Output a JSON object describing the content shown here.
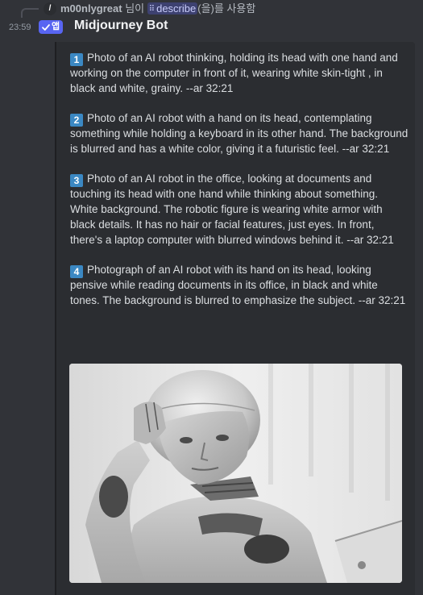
{
  "reply": {
    "username": "m00nlygreat",
    "honorific": "님이",
    "command": "describe",
    "suffix": "(을)를 사용함"
  },
  "message": {
    "timestamp": "23:59",
    "app_badge": "앱",
    "author": "Midjourney Bot"
  },
  "prompts": [
    {
      "number": "1",
      "text": "Photo of an AI robot thinking, holding its head with one hand and working on the computer in front of it, wearing white skin-tight , in black and white, grainy. --ar 32:21"
    },
    {
      "number": "2",
      "text": "Photo of an AI robot with a hand on its head, contemplating something while holding a keyboard in its other hand. The background is blurred and has a white color, giving it a futuristic feel. --ar 32:21"
    },
    {
      "number": "3",
      "text": "Photo of an AI robot in the office, looking at documents and touching its head with one hand while thinking about something. White background. The robotic figure is wearing white armor with black details. It has no hair or facial features, just eyes. In front, there's a laptop computer with blurred windows behind it. --ar 32:21"
    },
    {
      "number": "4",
      "text": "Photograph of an AI robot with its hand on its head, looking pensive while reading documents in its office, in black and white tones. The background is blurred to emphasize the subject. --ar 32:21"
    }
  ],
  "colors": {
    "background": "#313338",
    "embed": "#2b2d31",
    "badge": "#5865f2",
    "keycap": "#3b88c3",
    "text": "#dbdee1"
  }
}
